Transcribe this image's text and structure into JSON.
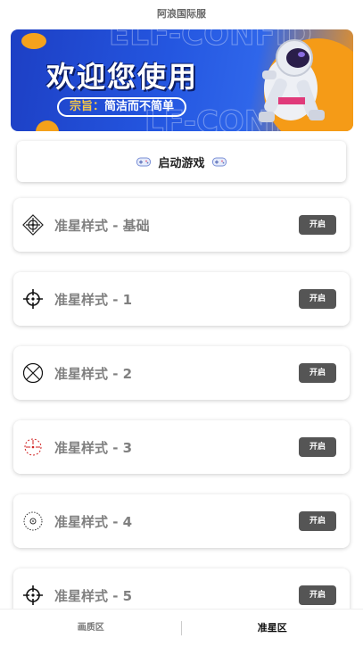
{
  "app": {
    "title": "阿浪国际服"
  },
  "banner": {
    "headline": "欢迎您使用",
    "slogan_prefix": "宗旨：",
    "slogan_text": "简洁而不简单"
  },
  "start": {
    "label": "启动游戏",
    "icon": "gamepad-icon"
  },
  "crosshairs": [
    {
      "name": "准星样式 - 基础",
      "button": "开启",
      "icon": "crosshair-basic-icon"
    },
    {
      "name": "准星样式 - 1",
      "button": "开启",
      "icon": "crosshair-1-icon"
    },
    {
      "name": "准星样式 - 2",
      "button": "开启",
      "icon": "crosshair-2-icon"
    },
    {
      "name": "准星样式 - 3",
      "button": "开启",
      "icon": "crosshair-3-icon"
    },
    {
      "name": "准星样式 - 4",
      "button": "开启",
      "icon": "crosshair-4-icon"
    },
    {
      "name": "准星样式 - 5",
      "button": "开启",
      "icon": "crosshair-5-icon"
    }
  ],
  "tabs": [
    {
      "label": "画质区",
      "active": false
    },
    {
      "label": "准星区",
      "active": true
    }
  ],
  "colors": {
    "button": "#555555",
    "banner_blue": "#2456e0",
    "banner_orange": "#f29419",
    "crosshair_red": "#d02020"
  }
}
